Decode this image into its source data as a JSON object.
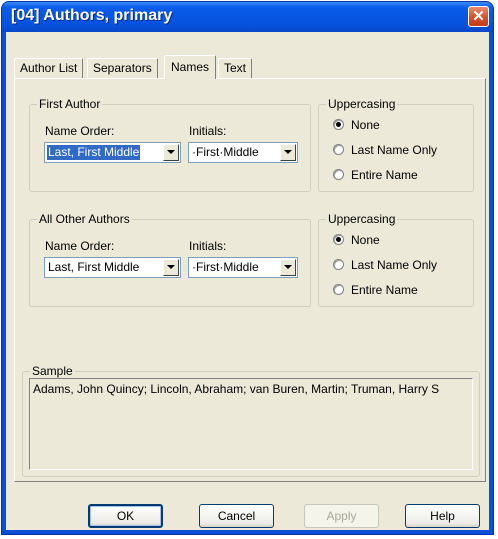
{
  "window": {
    "title": "[04] Authors, primary",
    "close_icon": "close-icon"
  },
  "tabs": [
    {
      "label": "Author List"
    },
    {
      "label": "Separators"
    },
    {
      "label": "Names",
      "active": true
    },
    {
      "label": "Text"
    }
  ],
  "first_author": {
    "group_label": "First Author",
    "name_order_label": "Name Order:",
    "name_order_value": "Last, First Middle",
    "initials_label": "Initials:",
    "initials_value": "·First·Middle"
  },
  "first_uppercasing": {
    "group_label": "Uppercasing",
    "options": [
      "None",
      "Last Name Only",
      "Entire Name"
    ],
    "selected": "None"
  },
  "other_authors": {
    "group_label": "All Other Authors",
    "name_order_label": "Name Order:",
    "name_order_value": "Last, First Middle",
    "initials_label": "Initials:",
    "initials_value": "·First·Middle"
  },
  "other_uppercasing": {
    "group_label": "Uppercasing",
    "options": [
      "None",
      "Last Name Only",
      "Entire Name"
    ],
    "selected": "None"
  },
  "sample": {
    "group_label": "Sample",
    "text": "Adams, John Quincy; Lincoln, Abraham; van Buren, Martin; Truman, Harry S"
  },
  "buttons": {
    "ok": "OK",
    "cancel": "Cancel",
    "apply": "Apply",
    "help": "Help"
  },
  "colors": {
    "title_bar": "#0a5ce8",
    "dialog_face": "#ece9d8",
    "selection": "#316ac5"
  }
}
